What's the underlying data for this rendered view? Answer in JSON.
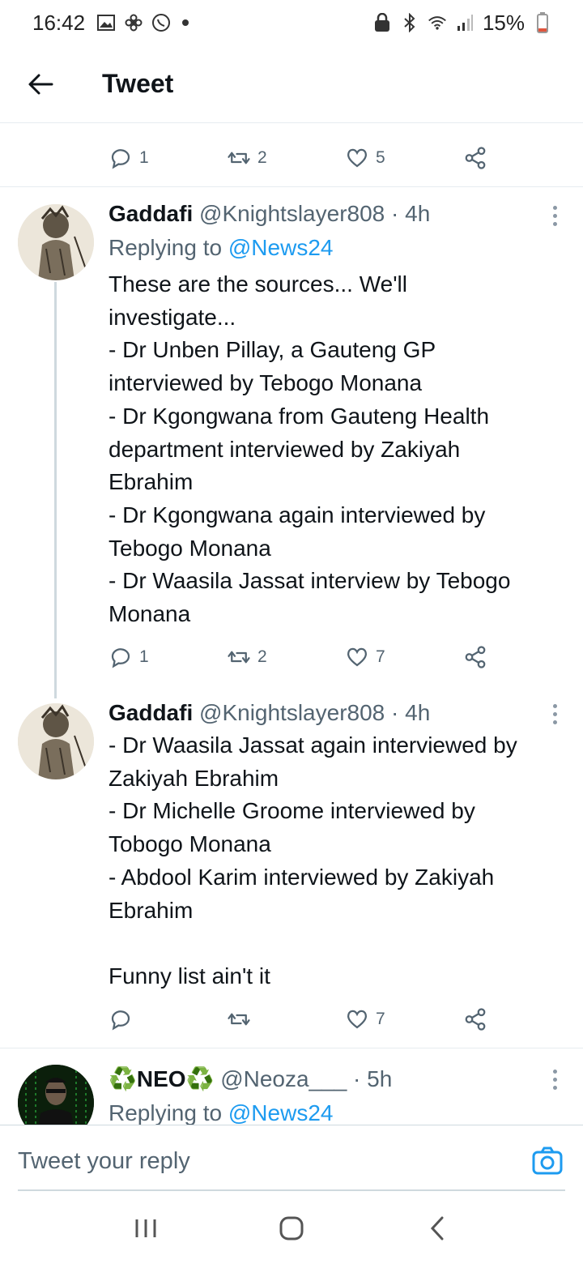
{
  "status_bar": {
    "time": "16:42",
    "battery": "15%",
    "icons": [
      "gallery-icon",
      "fan-icon",
      "whatsapp-icon",
      "dot-icon",
      "lock-icon",
      "bluetooth-icon",
      "wifi-icon",
      "signal-icon",
      "battery-icon"
    ]
  },
  "header": {
    "title": "Tweet",
    "back_icon": "arrow-left-icon"
  },
  "top_actions": {
    "replies": "1",
    "retweets": "2",
    "likes": "5"
  },
  "tweets": [
    {
      "name": "Gaddafi",
      "handle": "@Knightslayer808",
      "time": "· 4h",
      "replying_label": "Replying to",
      "replying_handle": "@News24",
      "text": "These are the sources... We'll\ninvestigate...\n- Dr Unben Pillay, a Gauteng GP\ninterviewed by Tebogo Monana\n- Dr Kgongwana from Gauteng Health\ndepartment interviewed by Zakiyah\nEbrahim\n- Dr Kgongwana again interviewed by\nTebogo Monana\n- Dr Waasila Jassat interview by Tebogo\nMonana",
      "replies": "1",
      "retweets": "2",
      "likes": "7"
    },
    {
      "name": "Gaddafi",
      "handle": "@Knightslayer808",
      "time": "· 4h",
      "text": "- Dr Waasila Jassat again interviewed by\nZakiyah Ebrahim\n- Dr Michelle Groome interviewed by\nTobogo Monana\n- Abdool Karim interviewed by Zakiyah\nEbrahim\n\nFunny list ain't it",
      "replies": "",
      "retweets": "",
      "likes": "7"
    },
    {
      "name": "♻️NEO♻️",
      "handle": "@Neoza___",
      "time": "· 5h",
      "replying_label": "Replying to",
      "replying_handle": "@News24"
    }
  ],
  "reply_bar": {
    "placeholder": "Tweet your reply",
    "camera_icon": "camera-icon"
  },
  "nav_bar": {
    "icons": [
      "recent-apps-icon",
      "home-icon",
      "back-icon"
    ]
  },
  "colors": {
    "link": "#1d9bf0",
    "secondary_text": "#536471",
    "primary_text": "#0f1419"
  }
}
